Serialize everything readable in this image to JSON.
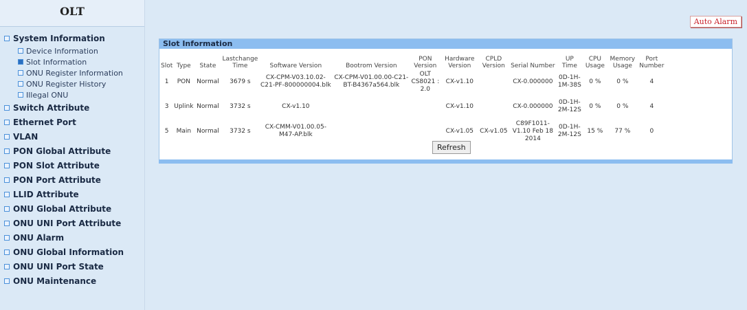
{
  "sidebar": {
    "logo": "OLT",
    "groups": [
      {
        "label": "System Information",
        "items": [
          "Device Information",
          "Slot Information",
          "ONU Register Information",
          "ONU Register History",
          "Illegal ONU"
        ]
      },
      {
        "label": "Switch Attribute"
      },
      {
        "label": "Ethernet Port"
      },
      {
        "label": "VLAN"
      },
      {
        "label": "PON Global Attribute"
      },
      {
        "label": "PON Slot Attribute"
      },
      {
        "label": "PON Port Attribute"
      },
      {
        "label": "LLID Attribute"
      },
      {
        "label": "ONU Global Attribute"
      },
      {
        "label": "ONU UNI Port Attribute"
      },
      {
        "label": "ONU Alarm"
      },
      {
        "label": "ONU Global Information"
      },
      {
        "label": "ONU UNI Port State"
      },
      {
        "label": "ONU Maintenance"
      }
    ],
    "active_item": "Slot Information"
  },
  "header": {
    "auto_alarm": "Auto Alarm"
  },
  "panel": {
    "title": "Slot Information",
    "columns": [
      "Slot",
      "Type",
      "State",
      "Lastchange Time",
      "Software Version",
      "Bootrom Version",
      "PON Version",
      "Hardware Version",
      "CPLD Version",
      "Serial Number",
      "UP Time",
      "CPU Usage",
      "Memory Usage",
      "Port Number"
    ],
    "rows": [
      [
        "1",
        "PON",
        "Normal",
        "3679 s",
        "CX-CPM-V03.10.02-C21-PF-800000004.blk",
        "CX-CPM-V01.00.00-C21-BT-B4367a564.blk",
        "OLT CS8021 : 2.0",
        "CX-v1.10",
        "",
        "CX-0.000000",
        "0D-1H-1M-38S",
        "0 %",
        "0 %",
        "4"
      ],
      [
        "3",
        "Uplink",
        "Normal",
        "3732 s",
        "CX-v1.10",
        "",
        "",
        "CX-v1.10",
        "",
        "CX-0.000000",
        "0D-1H-2M-12S",
        "0 %",
        "0 %",
        "4"
      ],
      [
        "5",
        "Main",
        "Normal",
        "3732 s",
        "CX-CMM-V01.00.05-M47-AP.blk",
        "",
        "",
        "CX-v1.05",
        "CX-v1.05",
        "C89F1011-V1.10 Feb 18 2014",
        "0D-1H-2M-12S",
        "15 %",
        "77 %",
        "0"
      ]
    ],
    "refresh_label": "Refresh"
  }
}
